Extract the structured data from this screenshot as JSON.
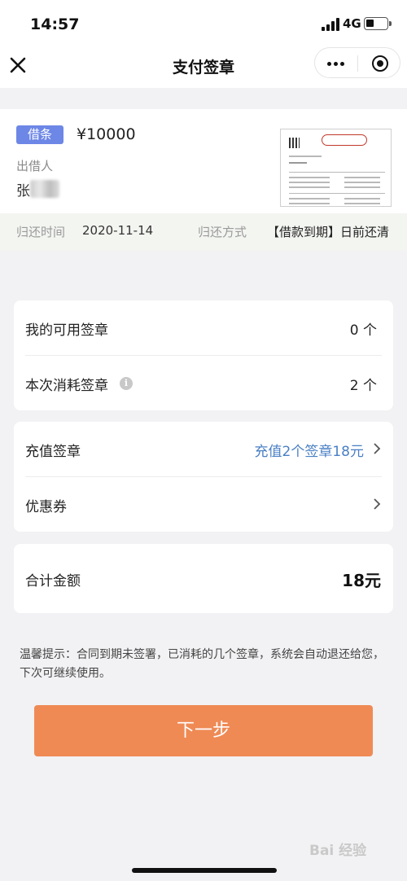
{
  "status_bar": {
    "time": "14:57",
    "network": "4G"
  },
  "navbar": {
    "title": "支付签章",
    "close_icon": "close-icon",
    "more_icon": "more-dots-icon",
    "target_icon": "target-icon"
  },
  "loan": {
    "badge": "借条",
    "amount": "¥10000",
    "lender_label": "出借人",
    "lender_name": "张",
    "return_time_label": "归还时间",
    "return_time": "2020-11-14",
    "return_method_label": "归还方式",
    "return_method": "【借款到期】日前还清"
  },
  "seals": {
    "available_label": "我的可用签章",
    "available_value": "0 个",
    "consumed_label": "本次消耗签章",
    "consumed_value": "2 个",
    "info_icon": "i"
  },
  "purchase": {
    "recharge_label": "充值签章",
    "recharge_value": "充值2个签章18元",
    "coupon_label": "优惠券"
  },
  "total": {
    "label": "合计金额",
    "value": "18元"
  },
  "notice": "温馨提示：合同到期未签署，已消耗的几个签章，系统会自动退还给您，下次可继续使用。",
  "next_button": "下一步",
  "watermark": "Bai 经验"
}
